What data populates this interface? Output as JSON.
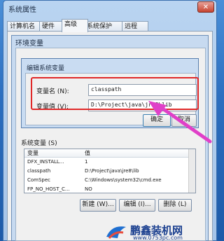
{
  "window": {
    "title": "系统属性",
    "close_symbol": "✕"
  },
  "tabs": [
    "计算机名",
    "硬件",
    "高级",
    "系统保护",
    "远程"
  ],
  "env_dialog": {
    "title": "环境变量",
    "system_vars_label": "系统变量 (S)"
  },
  "edit_dialog": {
    "title": "编辑系统变量",
    "name_label": "变量名 (N):",
    "name_value": "classpath",
    "value_label": "变量值 (V):",
    "value_value": "D:\\Project\\java\\jre8\\lib",
    "ok_label": "确定",
    "cancel_label": "取消"
  },
  "system_vars": {
    "columns": [
      "变量",
      "值"
    ],
    "rows": [
      {
        "name": "DFX_INSTALL...",
        "value": "1"
      },
      {
        "name": "classpath",
        "value": "D:\\Project\\java\\jre8\\lib"
      },
      {
        "name": "ComSpec",
        "value": "C:\\Windows\\system32\\cmd.exe"
      },
      {
        "name": "FP_NO_HOST_C...",
        "value": "NO"
      }
    ],
    "buttons": [
      "新建 (W)...",
      "编辑 (I)...",
      "删除 (L)"
    ]
  },
  "watermark": {
    "text": "鹏鑫装机网",
    "url": "www.0753pc.com"
  },
  "colors": {
    "highlight": "#e02828",
    "arrow": "#e040c8"
  }
}
